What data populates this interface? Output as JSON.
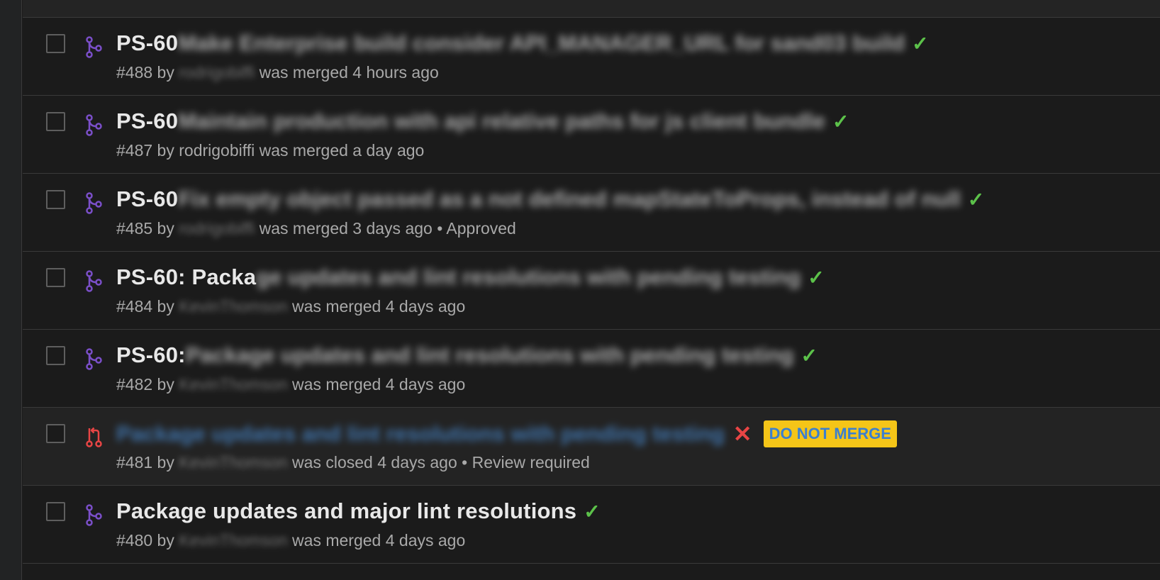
{
  "pull_requests": [
    {
      "title_prefix": "PS-60",
      "title_rest": " Make Enterprise build consider API_MANAGER_URL for sand03 build",
      "number": "#488",
      "by": " by ",
      "author": "rodrigobiffi",
      "status_text": " was merged 4 hours ago",
      "extra": "",
      "state": "merged",
      "ci": "pass",
      "label": ""
    },
    {
      "title_prefix": "PS-60",
      "title_rest": " Maintain production with api relative paths for js client bundle",
      "number": "#487",
      "by": " by ",
      "author": "rodrigobiffi",
      "status_text": " was merged a day ago",
      "extra": "",
      "state": "merged",
      "ci": "pass",
      "label": ""
    },
    {
      "title_prefix": "PS-60",
      "title_rest": " Fix empty object passed as a not defined mapStateToProps, instead of null",
      "number": "#485",
      "by": " by ",
      "author": "rodrigobiffi",
      "status_text": " was merged 3 days ago",
      "extra": " • Approved",
      "state": "merged",
      "ci": "pass",
      "label": ""
    },
    {
      "title_prefix": "PS-60: Packa",
      "title_rest": "ge updates and lint resolutions with pending testing",
      "number": "#484",
      "by": " by ",
      "author": "KevinThomson",
      "status_text": " was merged 4 days ago",
      "extra": "",
      "state": "merged",
      "ci": "pass",
      "label": ""
    },
    {
      "title_prefix": "PS-60:",
      "title_rest": " Package updates and lint resolutions with pending testing",
      "number": "#482",
      "by": " by ",
      "author": "KevinThomson",
      "status_text": " was merged 4 days ago",
      "extra": "",
      "state": "merged",
      "ci": "pass",
      "label": ""
    },
    {
      "title_prefix": "",
      "title_rest": "Package updates and lint resolutions with pending testing",
      "number": "#481",
      "by": " by ",
      "author": "KevinThomson",
      "status_text": " was closed 4 days ago",
      "extra": " • Review required",
      "state": "closed",
      "ci": "fail",
      "label": "DO NOT MERGE"
    },
    {
      "title_prefix": "Package updates and major lint resolutions",
      "title_rest": "",
      "number": "#480",
      "by": " by ",
      "author": "KevinThomson",
      "status_text": " was merged 4 days ago",
      "extra": "",
      "state": "merged",
      "ci": "pass",
      "label": ""
    }
  ],
  "glyphs": {
    "check": "✓",
    "cross": "✕"
  },
  "colors": {
    "merged_icon": "#7b4fc9",
    "closed_icon": "#e84545",
    "ci_pass": "#5cc24a",
    "ci_fail": "#e84545",
    "label_bg": "#f5c518",
    "link_blue": "#4a8fd9"
  }
}
